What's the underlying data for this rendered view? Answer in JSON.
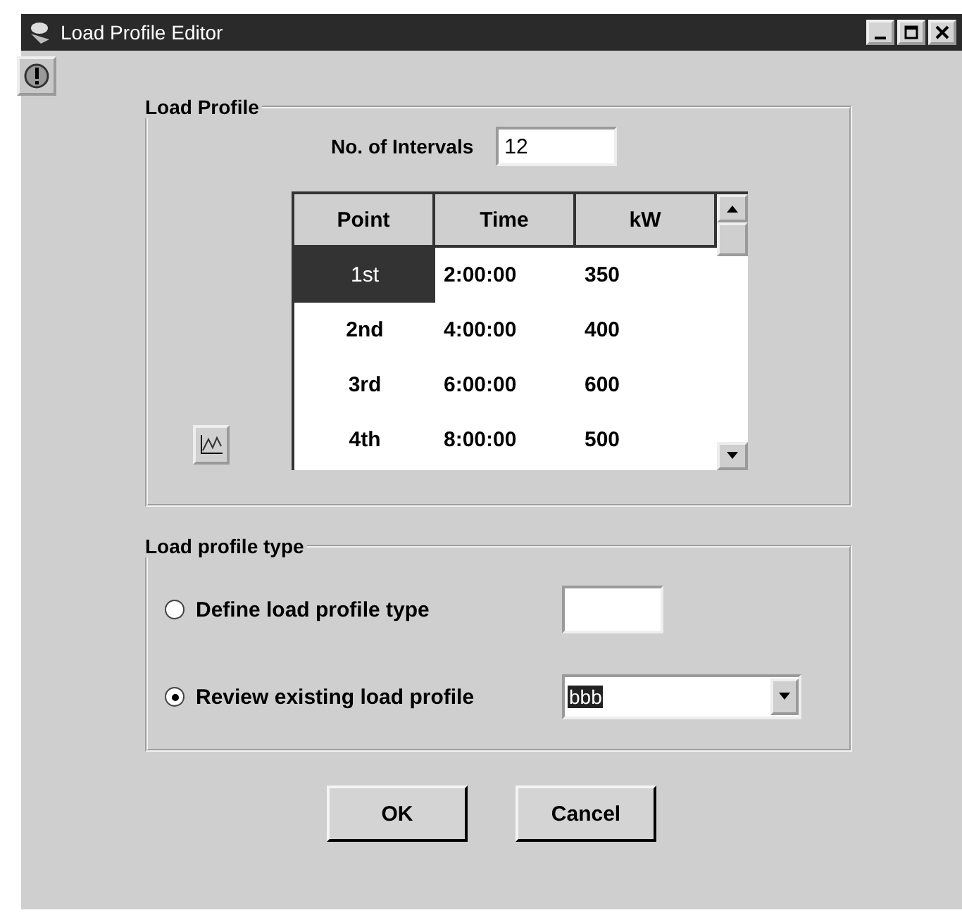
{
  "window": {
    "title": "Load Profile Editor"
  },
  "load_profile": {
    "title": "Load Profile",
    "intervals_label": "No. of Intervals",
    "intervals_value": "12",
    "table": {
      "columns": [
        "Point",
        "Time",
        "kW"
      ],
      "rows": [
        {
          "cells": [
            "1st",
            "2:00:00",
            "350"
          ],
          "selected": true
        },
        {
          "cells": [
            "2nd",
            "4:00:00",
            "400"
          ],
          "selected": false
        },
        {
          "cells": [
            "3rd",
            "6:00:00",
            "600"
          ],
          "selected": false
        },
        {
          "cells": [
            "4th",
            "8:00:00",
            "500"
          ],
          "selected": false
        }
      ]
    }
  },
  "load_profile_type": {
    "title": "Load profile type",
    "options": [
      {
        "label": "Define load profile type",
        "selected": false,
        "kind": "text"
      },
      {
        "label": "Review existing load profile",
        "selected": true,
        "kind": "dropdown",
        "value": "bbb"
      }
    ]
  },
  "buttons": [
    "OK",
    "Cancel"
  ]
}
